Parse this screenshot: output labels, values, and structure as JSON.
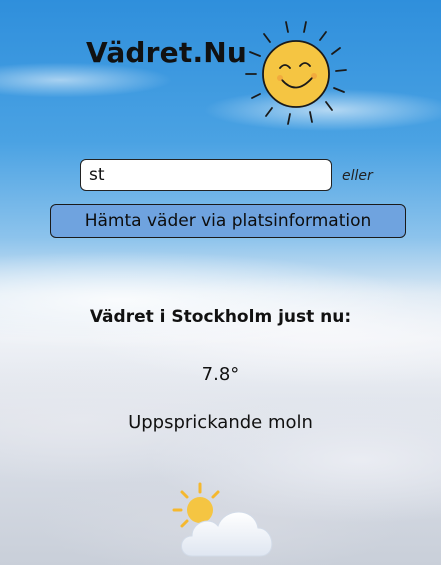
{
  "app": {
    "title": "Vädret.Nu",
    "logo_icon": "smiling-sun-icon"
  },
  "search": {
    "value": "st",
    "or_label": "eller",
    "geo_button_label": "Hämta väder via platsinformation"
  },
  "weather": {
    "heading": "Vädret i Stockholm just nu:",
    "temperature": "7.8°",
    "description": "Uppsprickande moln",
    "icon": "partly-cloudy-icon"
  },
  "colors": {
    "button_bg": "#6fa3df",
    "sun_yellow": "#f5c542",
    "sky_blue": "#2f8fdc"
  }
}
